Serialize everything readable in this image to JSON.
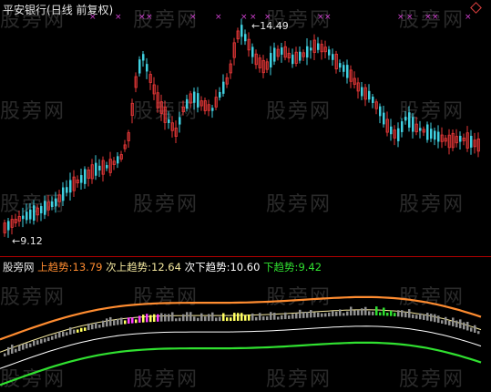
{
  "header": {
    "stock_name": "平安银行",
    "period_label": "(日线 前复权)"
  },
  "main_chart": {
    "high_marker": "14.49",
    "low_marker": "9.12",
    "signal_marker": "×",
    "up_color": "#e83838",
    "down_color": "#40d0e0",
    "signal_color": "#d040d0"
  },
  "indicator": {
    "name": "股旁网",
    "items": [
      {
        "label": "上趋势:",
        "value": "13.79",
        "color": "#ff8c30"
      },
      {
        "label": "次上趋势:",
        "value": "12.64",
        "color": "#f5e9a0"
      },
      {
        "label": "次下趋势:",
        "value": "10.60",
        "color": "#ffffff"
      },
      {
        "label": "下趋势:",
        "value": "9.42",
        "color": "#30e030"
      }
    ]
  },
  "watermark": "股旁网",
  "chart_data": {
    "type": "line",
    "title": "平安银行(日线 前复权)",
    "price_high": 14.49,
    "price_low": 9.12,
    "series": [
      {
        "name": "上趋势",
        "last_value": 13.79
      },
      {
        "name": "次上趋势",
        "last_value": 12.64
      },
      {
        "name": "次下趋势",
        "last_value": 10.6
      },
      {
        "name": "下趋势",
        "last_value": 9.42
      }
    ]
  }
}
